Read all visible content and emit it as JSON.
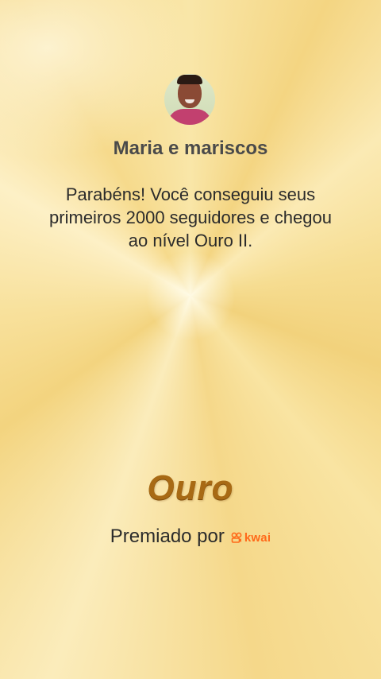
{
  "profile": {
    "name": "Maria e mariscos",
    "avatar_icon": "user-avatar"
  },
  "message": "Parabéns! Você conseguiu seus primeiros 2000 seguidores e chegou ao nível Ouro II.",
  "level": {
    "title": "Ouro",
    "color": "#a86a14"
  },
  "award": {
    "label": "Premiado por",
    "brand": "kwai",
    "brand_color": "#ff6a1a"
  }
}
